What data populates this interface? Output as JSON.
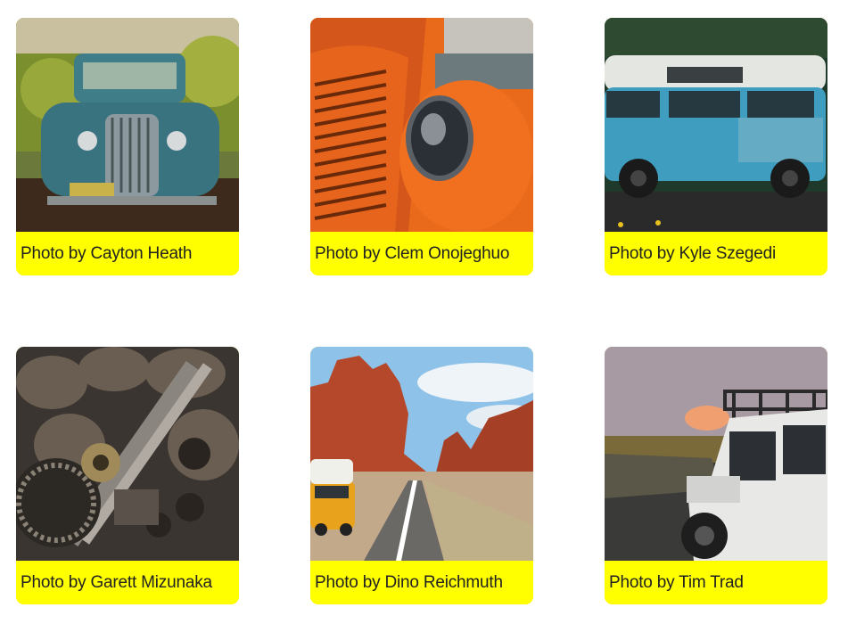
{
  "accent_color": "#ffff00",
  "gallery": [
    {
      "image": "vintage-blue-truck-in-vineyard",
      "caption": "Photo by Cayton Heath"
    },
    {
      "image": "orange-classic-car-headlight",
      "caption": "Photo by Clem Onojeghuo"
    },
    {
      "image": "rusty-blue-vw-van",
      "caption": "Photo by Kyle Szegedi"
    },
    {
      "image": "engine-camshaft-closeup",
      "caption": "Photo by Garett Mizunaka"
    },
    {
      "image": "yellow-van-desert-road",
      "caption": "Photo by Dino Reichmuth"
    },
    {
      "image": "white-land-rover-sunset",
      "caption": "Photo by Tim Trad"
    }
  ]
}
